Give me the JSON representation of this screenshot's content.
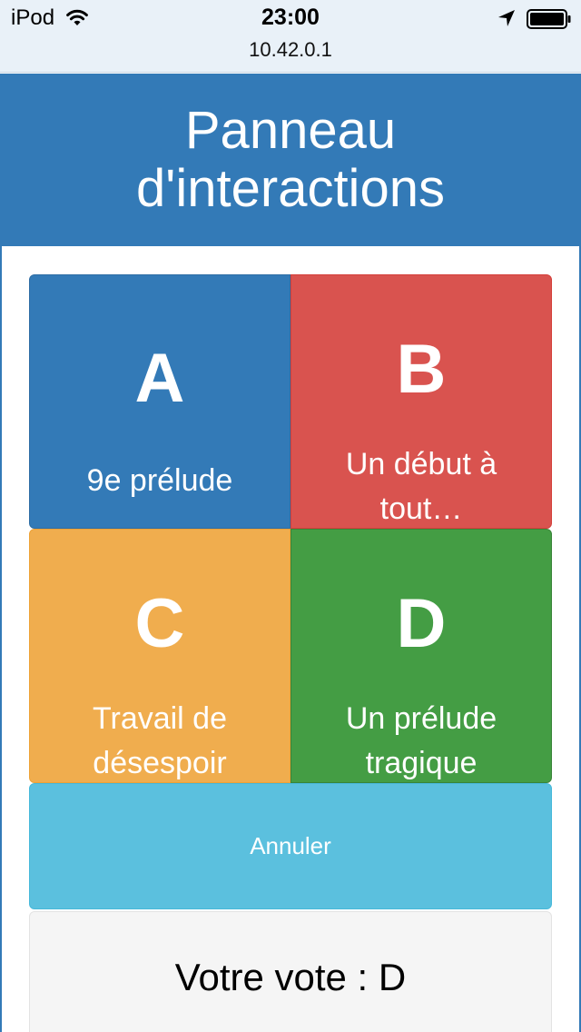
{
  "status_bar": {
    "carrier": "iPod",
    "time": "23:00",
    "url": "10.42.0.1",
    "icons": [
      "wifi-icon",
      "location-icon",
      "battery-icon"
    ]
  },
  "header": {
    "title": "Panneau d'interactions",
    "background": "#337ab7"
  },
  "choices": [
    {
      "letter": "A",
      "label": "9e prélude",
      "color": "#337ab7"
    },
    {
      "letter": "B",
      "label": "Un début à tout…",
      "color": "#d9534f"
    },
    {
      "letter": "C",
      "label": "Travail de désespoir",
      "color": "#f0ad4e"
    },
    {
      "letter": "D",
      "label": "Un prélude tragique",
      "color": "#449d44"
    }
  ],
  "cancel": {
    "label": "Annuler",
    "color": "#5bc0de"
  },
  "vote": {
    "text": "Votre vote : D"
  }
}
